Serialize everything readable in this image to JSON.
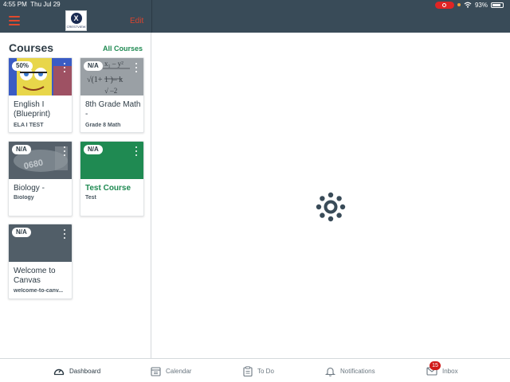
{
  "status_bar": {
    "time": "4:55 PM",
    "date": "Thu Jul 29",
    "battery_percent": "93%",
    "battery_level": 0.93
  },
  "header": {
    "edit_label": "Edit",
    "logo_text": "CRESTVIEW",
    "colors": {
      "background": "#394b58",
      "accent": "#e0492d"
    }
  },
  "courses": {
    "title": "Courses",
    "all_courses_label": "All Courses",
    "link_color": "#1f8a52",
    "cards": [
      {
        "name": "English I (Blueprint)",
        "code": "ELA I TEST",
        "grade": "50%",
        "image": "cartoon-sponge-image",
        "color": "#3a5cc4"
      },
      {
        "name": "8th Grade Math -",
        "code": "Grade 8 Math",
        "grade": "N/A",
        "image": "math-formula-image",
        "color": "#8f959a"
      },
      {
        "name": "Biology -",
        "code": "Biology",
        "grade": "N/A",
        "image": "lab-equipment-image",
        "color": "#5b6168"
      },
      {
        "name": "Test Course",
        "code": "Test",
        "grade": "N/A",
        "image": "",
        "color": "#1f8a52"
      },
      {
        "name": "Welcome to Canvas",
        "code": "welcome-to-canv...",
        "grade": "N/A",
        "image": "",
        "color": "#515e68"
      }
    ]
  },
  "main": {
    "spinner_icon": "canvas-loading-icon"
  },
  "tab_bar": {
    "tabs": [
      {
        "label": "Dashboard",
        "icon": "dashboard-icon",
        "active": true
      },
      {
        "label": "Calendar",
        "icon": "calendar-icon",
        "active": false
      },
      {
        "label": "To Do",
        "icon": "todo-icon",
        "active": false
      },
      {
        "label": "Notifications",
        "icon": "bell-icon",
        "active": false
      },
      {
        "label": "Inbox",
        "icon": "inbox-icon",
        "active": false,
        "badge": "15"
      }
    ]
  }
}
